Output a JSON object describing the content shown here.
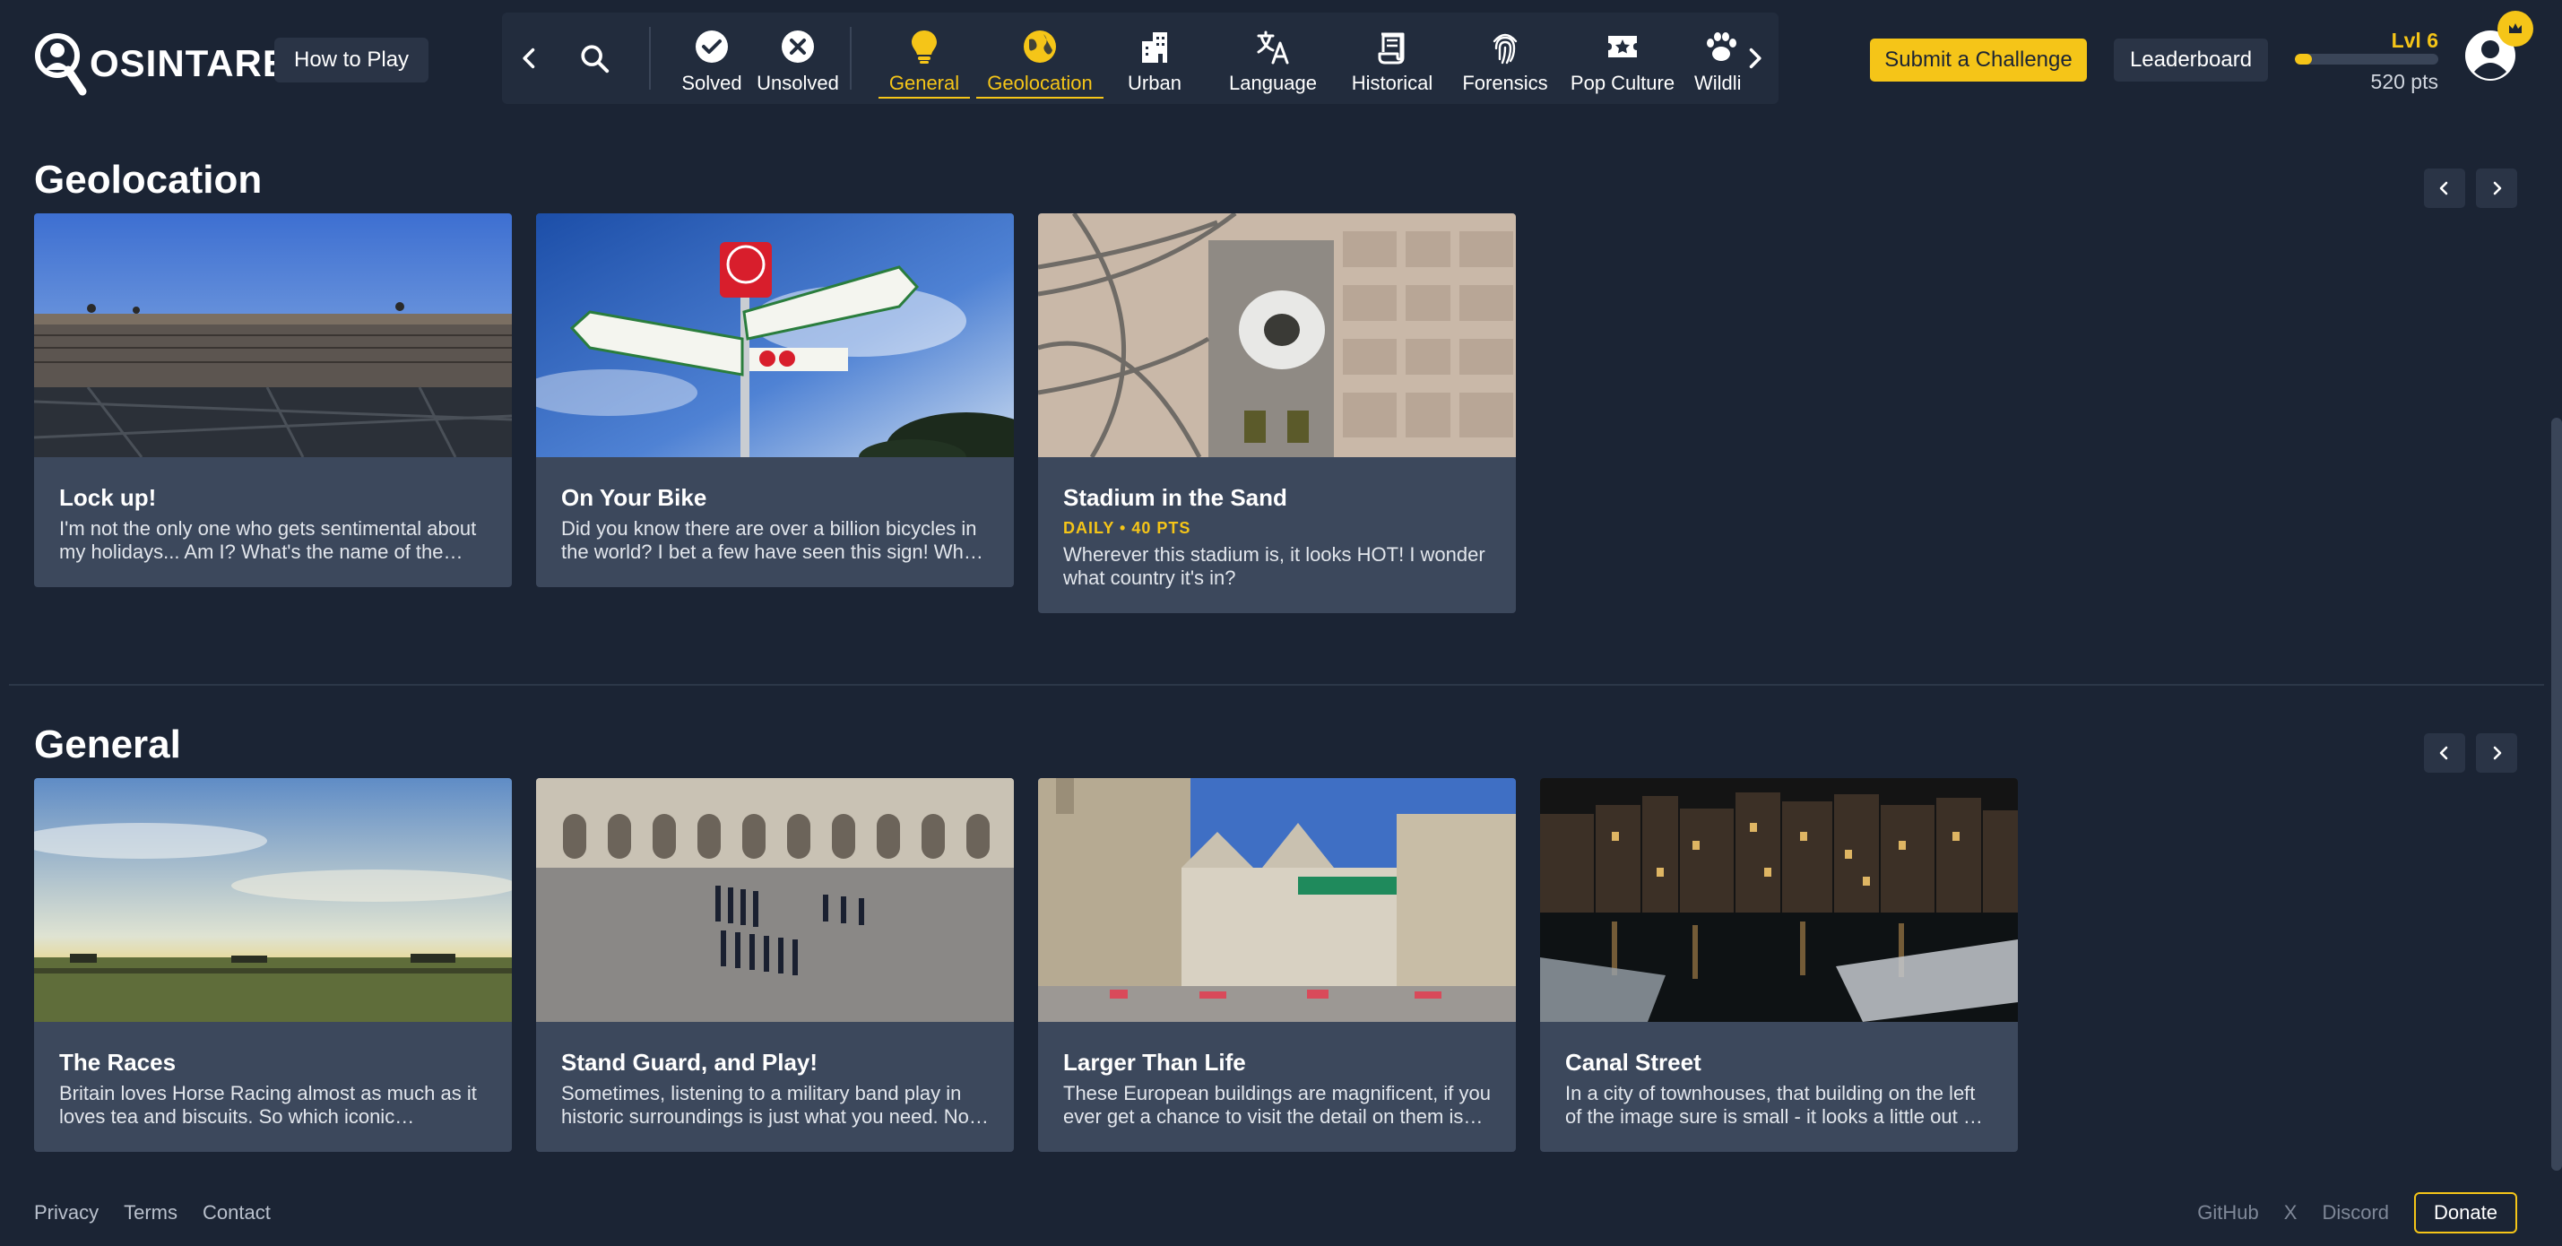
{
  "brand": {
    "name": "OSINTARENA",
    "accent": "#f5c518",
    "background": "#1b2434"
  },
  "header": {
    "how_to_play": "How to Play",
    "submit_challenge": "Submit a Challenge",
    "leaderboard": "Leaderboard",
    "level": "Lvl 6",
    "points": "520 pts",
    "level_progress": 0.12
  },
  "categories": {
    "solved": "Solved",
    "unsolved": "Unsolved",
    "general": "General",
    "geolocation": "Geolocation",
    "urban": "Urban",
    "language": "Language",
    "historical": "Historical",
    "forensics": "Forensics",
    "pop_culture": "Pop Culture",
    "wildlife": "Wildli",
    "active": [
      "General",
      "Geolocation"
    ]
  },
  "sections": {
    "geolocation": {
      "title": "Geolocation",
      "cards": [
        {
          "title": "Lock up!",
          "desc": "I'm not the only one who gets sentimental about my holidays... Am I? What's the name of the bridge?",
          "daily": ""
        },
        {
          "title": "On Your Bike",
          "desc": "Did you know there are over a billion bicycles in the world? I bet a few have seen this sign! What town is this?",
          "daily": ""
        },
        {
          "title": "Stadium in the Sand",
          "desc": "Wherever this stadium is, it looks HOT! I wonder what country it's in?",
          "daily": "DAILY • 40 PTS"
        }
      ]
    },
    "general": {
      "title": "General",
      "cards": [
        {
          "title": "The Races",
          "desc": "Britain loves Horse Racing almost as much as it loves tea and biscuits. So which iconic racecourse is this?",
          "daily": ""
        },
        {
          "title": "Stand Guard, and Play!",
          "desc": "Sometimes, listening to a military band play in historic surroundings is just what you need. Now where is this?",
          "daily": ""
        },
        {
          "title": "Larger Than Life",
          "desc": "These European buildings are magnificent, if you ever get a chance to visit the detail on them is amazing.",
          "daily": ""
        },
        {
          "title": "Canal Street",
          "desc": "In a city of townhouses, that building on the left of the image sure is small - it looks a little out of place.",
          "daily": ""
        }
      ]
    }
  },
  "footer": {
    "privacy": "Privacy",
    "terms": "Terms",
    "contact": "Contact",
    "github": "GitHub",
    "x": "X",
    "discord": "Discord",
    "donate": "Donate"
  },
  "icons": [
    "logo-magnifier-icon",
    "search-icon",
    "check-circle-icon",
    "x-circle-icon",
    "lightbulb-icon",
    "globe-icon",
    "buildings-icon",
    "translate-icon",
    "scroll-icon",
    "fingerprint-icon",
    "ticket-icon",
    "paw-icon",
    "chevron-left-icon",
    "chevron-right-icon",
    "user-avatar-icon",
    "crown-icon"
  ]
}
